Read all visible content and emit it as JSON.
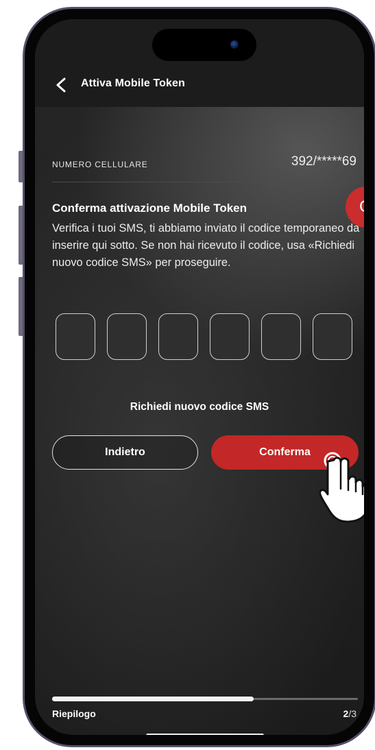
{
  "header": {
    "title": "Attiva Mobile Token"
  },
  "phone": {
    "label": "NUMERO CELLULARE",
    "value": "392/*****69"
  },
  "confirm_section": {
    "title": "Conferma attivazione Mobile Token",
    "body": "Verifica i tuoi SMS, ti abbiamo inviato il codice temporaneo da inserire qui sotto. Se non hai ricevuto il codice, usa «Richiedi nuovo codice SMS» per proseguire."
  },
  "code": {
    "digits": [
      "",
      "",
      "",
      "",
      "",
      ""
    ]
  },
  "actions": {
    "resend_label": "Richiedi nuovo codice SMS",
    "back_label": "Indietro",
    "confirm_label": "Conferma"
  },
  "badge": {
    "text": "C"
  },
  "progress": {
    "label": "Riepilogo",
    "current": "2",
    "total": "/3",
    "fraction": 0.66
  },
  "colors": {
    "accent": "#c42727",
    "background": "#222222",
    "text": "#ffffff"
  },
  "icons": {
    "back": "chevron-left-icon",
    "cursor": "hand-pointer-icon"
  }
}
